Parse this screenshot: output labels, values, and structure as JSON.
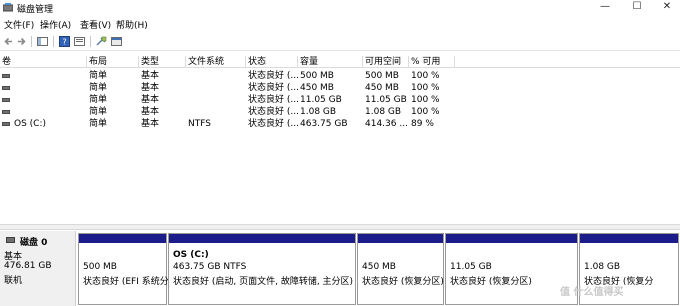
{
  "window": {
    "title": "磁盘管理",
    "controls": {
      "minimize": "—",
      "maximize": "☐",
      "close": "✕"
    }
  },
  "menu": [
    "文件(F)",
    "操作(A)",
    "查看(V)",
    "帮助(H)"
  ],
  "toolbar": [
    "back-icon",
    "forward-icon",
    "show-hide-icon",
    "help-icon",
    "properties-icon",
    "connect-icon",
    "console-icon"
  ],
  "table": {
    "headers": [
      "卷",
      "布局",
      "类型",
      "文件系统",
      "状态",
      "容量",
      "可用空间",
      "% 可用"
    ],
    "rows": [
      {
        "volume": "",
        "layout": "简单",
        "type": "基本",
        "fs": "",
        "status": "状态良好 (...",
        "capacity": "500 MB",
        "free": "500 MB",
        "pct": "100 %"
      },
      {
        "volume": "",
        "layout": "简单",
        "type": "基本",
        "fs": "",
        "status": "状态良好 (...",
        "capacity": "450 MB",
        "free": "450 MB",
        "pct": "100 %"
      },
      {
        "volume": "",
        "layout": "简单",
        "type": "基本",
        "fs": "",
        "status": "状态良好 (...",
        "capacity": "11.05 GB",
        "free": "11.05 GB",
        "pct": "100 %"
      },
      {
        "volume": "",
        "layout": "简单",
        "type": "基本",
        "fs": "",
        "status": "状态良好 (...",
        "capacity": "1.08 GB",
        "free": "1.08 GB",
        "pct": "100 %"
      },
      {
        "volume": "OS (C:)",
        "layout": "简单",
        "type": "基本",
        "fs": "NTFS",
        "status": "状态良好 (...",
        "capacity": "463.75 GB",
        "free": "414.36 ...",
        "pct": "89 %"
      }
    ]
  },
  "disk": {
    "name": "磁盘 0",
    "type": "基本",
    "size": "476.81 GB",
    "state": "联机",
    "partitions": [
      {
        "title": "",
        "size": "500 MB",
        "status": "状态良好 (EFI 系统分"
      },
      {
        "title": "OS  (C:)",
        "size": "463.75 GB NTFS",
        "status": "状态良好 (启动, 页面文件, 故障转储, 主分区)"
      },
      {
        "title": "",
        "size": "450 MB",
        "status": "状态良好 (恢复分区)"
      },
      {
        "title": "",
        "size": "11.05 GB",
        "status": "状态良好 (恢复分区)"
      },
      {
        "title": "",
        "size": "1.08 GB",
        "status": "状态良好 (恢复分"
      }
    ]
  },
  "watermark": "值 什么值得买"
}
